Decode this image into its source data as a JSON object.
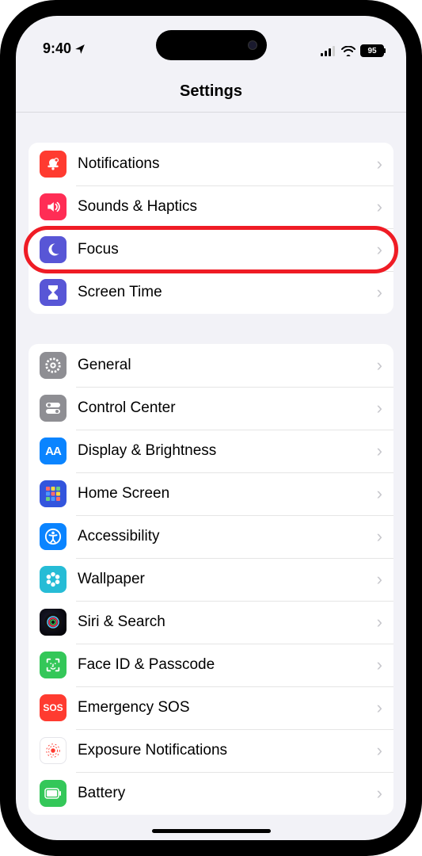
{
  "status": {
    "time": "9:40",
    "battery": "95"
  },
  "title": "Settings",
  "group1": [
    {
      "id": "notifications",
      "label": "Notifications",
      "icon_bg": "#ff3b30",
      "svg": "bell"
    },
    {
      "id": "sounds-haptics",
      "label": "Sounds & Haptics",
      "icon_bg": "#ff2d55",
      "svg": "speaker"
    },
    {
      "id": "focus",
      "label": "Focus",
      "icon_bg": "#5856d6",
      "svg": "moon",
      "highlighted": true
    },
    {
      "id": "screen-time",
      "label": "Screen Time",
      "icon_bg": "#5856d6",
      "svg": "hourglass"
    }
  ],
  "group2": [
    {
      "id": "general",
      "label": "General",
      "icon_bg": "#8e8e93",
      "svg": "gear"
    },
    {
      "id": "control-center",
      "label": "Control Center",
      "icon_bg": "#8e8e93",
      "svg": "toggles"
    },
    {
      "id": "display-brightness",
      "label": "Display & Brightness",
      "icon_bg": "#0a84ff",
      "svg": "AA"
    },
    {
      "id": "home-screen",
      "label": "Home Screen",
      "icon_bg": "#3355dd",
      "svg": "grid"
    },
    {
      "id": "accessibility",
      "label": "Accessibility",
      "icon_bg": "#0a84ff",
      "svg": "acc"
    },
    {
      "id": "wallpaper",
      "label": "Wallpaper",
      "icon_bg": "#26bcd6",
      "svg": "flower"
    },
    {
      "id": "siri-search",
      "label": "Siri & Search",
      "icon_bg": "grad",
      "svg": "siri"
    },
    {
      "id": "face-id",
      "label": "Face ID & Passcode",
      "icon_bg": "#34c759",
      "svg": "face"
    },
    {
      "id": "emergency-sos",
      "label": "Emergency SOS",
      "icon_bg": "#ff3b30",
      "svg": "SOS"
    },
    {
      "id": "exposure",
      "label": "Exposure Notifications",
      "icon_bg": "#ffffff",
      "svg": "expo"
    },
    {
      "id": "battery",
      "label": "Battery",
      "icon_bg": "#34c759",
      "svg": "batt"
    }
  ]
}
